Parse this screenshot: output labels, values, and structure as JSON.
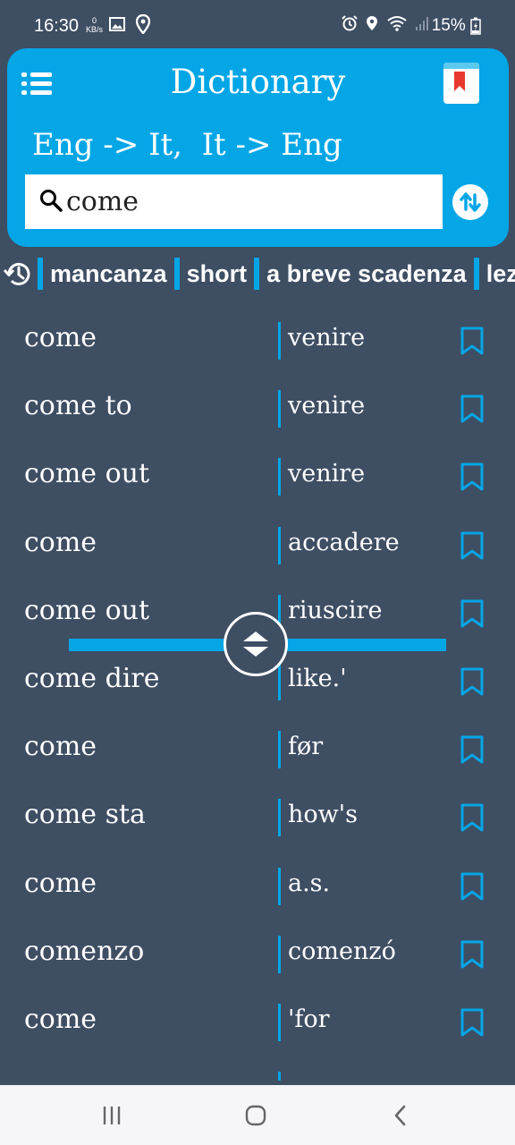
{
  "status_bar": {
    "time": "16:30",
    "net_speed_value": "0",
    "net_speed_unit": "KB/s",
    "battery": "15%"
  },
  "header": {
    "title": "Dictionary",
    "languages": "Eng -> It,  It -> Eng",
    "search_value": "come",
    "menu_icon": "hamburger-list-icon",
    "bookmarks_icon": "bookmark-book-icon",
    "swap_icon": "swap-arrows-icon"
  },
  "history": {
    "icon": "history-clock-icon",
    "items": [
      "mancanza",
      "short",
      "a breve scadenza",
      "lez"
    ]
  },
  "results": [
    {
      "en": "come",
      "it": "venire"
    },
    {
      "en": "come to",
      "it": "venire"
    },
    {
      "en": "come out",
      "it": "venire"
    },
    {
      "en": "come",
      "it": "accadere"
    },
    {
      "en": "come out",
      "it": "riuscire"
    },
    {
      "en": "come dire",
      "it": "like.'"
    },
    {
      "en": "come",
      "it": "før"
    },
    {
      "en": "come sta",
      "it": "how's"
    },
    {
      "en": "come",
      "it": "a.s."
    },
    {
      "en": "comenzo",
      "it": "comenzó"
    },
    {
      "en": "come",
      "it": "'for"
    }
  ],
  "colors": {
    "background": "#3e4e63",
    "accent": "#05a6e6",
    "bookmark_ribbon": "#e8392f",
    "navbar": "#f6f6f8"
  },
  "navbar": {
    "icons": [
      "recent-apps-icon",
      "home-icon",
      "back-icon"
    ]
  }
}
